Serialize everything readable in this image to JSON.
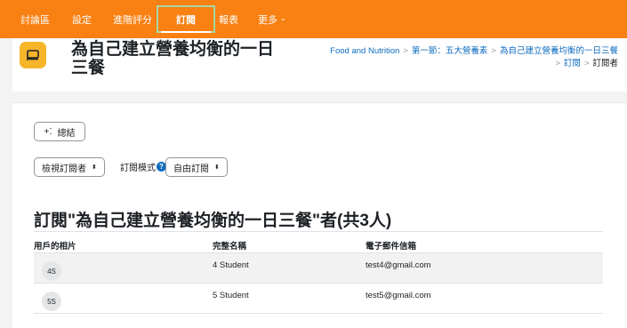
{
  "nav": {
    "items": [
      {
        "label": "討論區"
      },
      {
        "label": "設定"
      },
      {
        "label": "進階評分"
      },
      {
        "label": "訂閱"
      },
      {
        "label": "報表"
      },
      {
        "label": "更多"
      }
    ],
    "active_index": 3
  },
  "header": {
    "title": "為自己建立營養均衡的一日三餐",
    "breadcrumb": [
      "Food and Nutrition",
      "第一節：五大營養素",
      "為自己建立營養均衡的一日三餐",
      "訂閱",
      "訂閱者"
    ]
  },
  "actions": {
    "summary_label": "總結",
    "view_select": "檢視訂閱者",
    "mode_label": "訂閱模式",
    "mode_select": "自由訂閱"
  },
  "section": {
    "title": "訂閱\"為自己建立營養均衡的一日三餐\"者(共3人)"
  },
  "table": {
    "headers": [
      "用戶的相片",
      "完整名稱",
      "電子郵件信箱"
    ],
    "rows": [
      {
        "initials": "4S",
        "name": "4 Student",
        "email": "test4@gmail.com"
      },
      {
        "initials": "5S",
        "name": "5 Student",
        "email": "test5@gmail.com"
      }
    ]
  },
  "colors": {
    "nav_bg": "#f98012",
    "active_outline": "#a8d7a3",
    "link": "#0f6cbf",
    "icon_bg": "#f7b52a"
  }
}
